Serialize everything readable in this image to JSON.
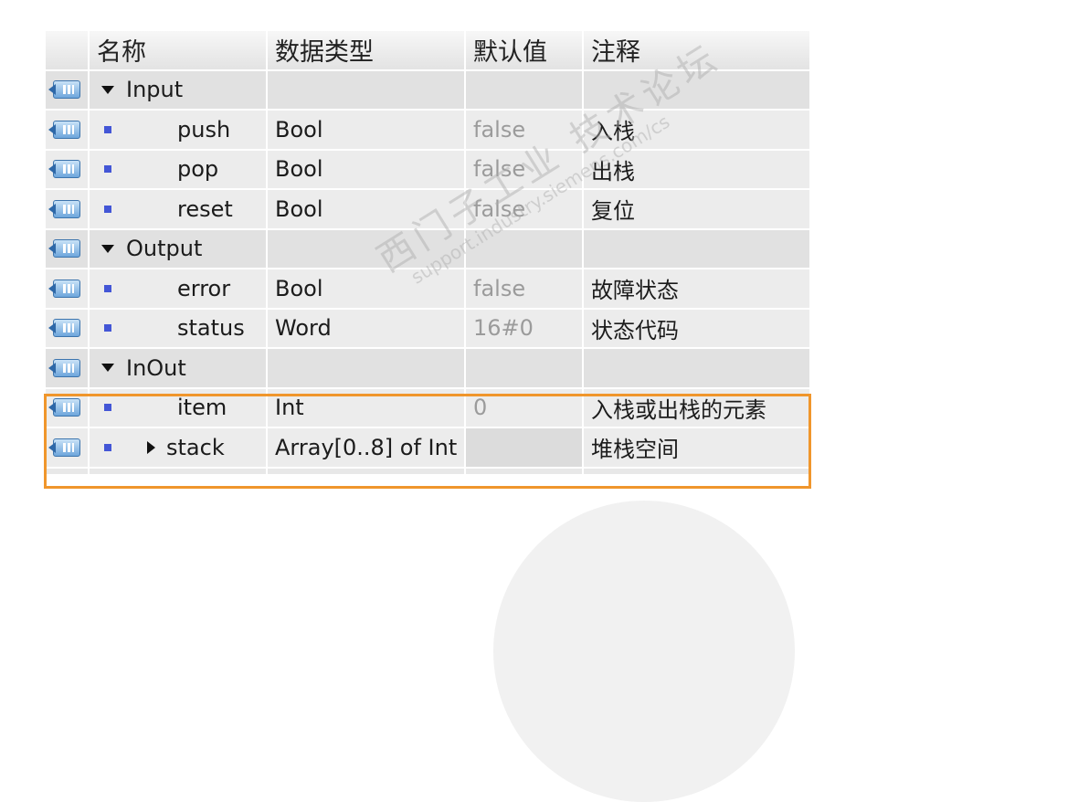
{
  "columns": [
    "名称",
    "数据类型",
    "默认值",
    "注释"
  ],
  "sections": [
    {
      "label": "Input",
      "rows": [
        {
          "name": "push",
          "type": "Bool",
          "default": "false",
          "comment": "入栈"
        },
        {
          "name": "pop",
          "type": "Bool",
          "default": "false",
          "comment": "出栈"
        },
        {
          "name": "reset",
          "type": "Bool",
          "default": "false",
          "comment": "复位"
        }
      ]
    },
    {
      "label": "Output",
      "rows": [
        {
          "name": "error",
          "type": "Bool",
          "default": "false",
          "comment": "故障状态"
        },
        {
          "name": "status",
          "type": "Word",
          "default": "16#0",
          "comment": "状态代码"
        }
      ]
    },
    {
      "label": "InOut",
      "rows": [
        {
          "name": "item",
          "type": "Int",
          "default": "0",
          "comment": "入栈或出栈的元素"
        },
        {
          "name": "stack",
          "type": "Array[0..8] of Int",
          "default": "",
          "comment": "堆栈空间"
        }
      ]
    }
  ],
  "watermark": {
    "line1": "西门子工业  技术论坛",
    "line2": "support.industry.siemens.com/cs"
  },
  "colors": {
    "highlight": "#f0962c",
    "bullet": "#4356d6"
  }
}
